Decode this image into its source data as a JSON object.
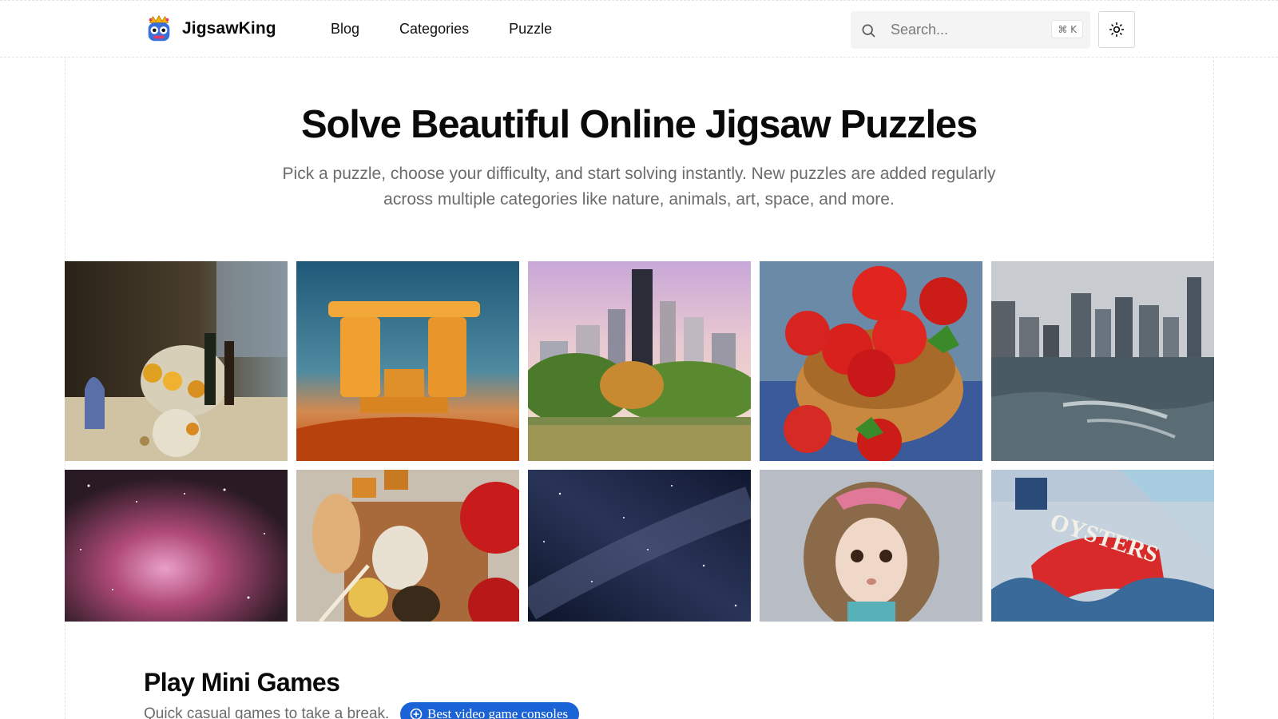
{
  "brand": {
    "name": "JigsawKing",
    "logo_icon": "crowned-monster-logo-icon"
  },
  "nav": {
    "links": [
      "Blog",
      "Categories",
      "Puzzle"
    ]
  },
  "search": {
    "placeholder": "Search...",
    "shortcut": "⌘ K",
    "icon": "search-icon"
  },
  "theme_toggle": {
    "icon": "sun-icon"
  },
  "hero": {
    "title": "Solve Beautiful Online Jigsaw Puzzles",
    "subtitle": "Pick a puzzle, choose your difficulty, and start solving instantly. New puzzles are added regularly across multiple categories like nature, animals, art, space, and more."
  },
  "puzzles": [
    {
      "subject": "Still life with fruit basket and wine"
    },
    {
      "subject": "Stone arch sculpture at sunset"
    },
    {
      "subject": "City skyline over park and lake"
    },
    {
      "subject": "Strawberries in a wooden bowl"
    },
    {
      "subject": "City skyline across choppy water"
    },
    {
      "subject": "Pink nebula in space"
    },
    {
      "subject": "Chocolate dipped fruit sweets"
    },
    {
      "subject": "Milky way night sky"
    },
    {
      "subject": "Doll with curly hair and pink bow"
    },
    {
      "subject": "Oysters sign on building mural"
    }
  ],
  "games": {
    "title": "Play Mini Games",
    "subtitle": "Quick casual games to take a break."
  },
  "ad": {
    "label": "Best video game consoles",
    "icon": "plus-circle-icon",
    "color": "#1a63d6"
  }
}
